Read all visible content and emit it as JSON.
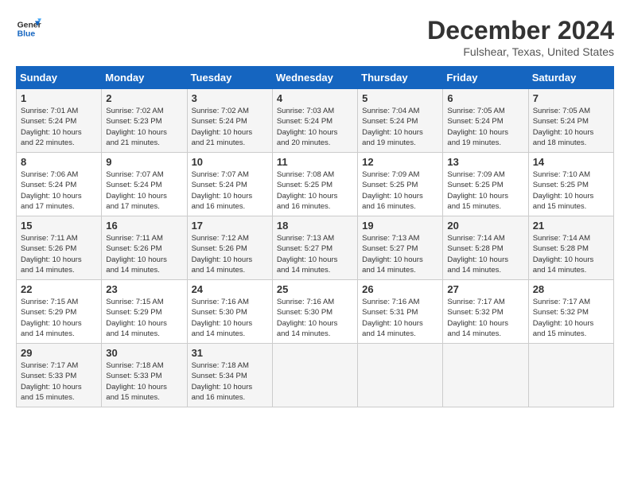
{
  "header": {
    "logo_line1": "General",
    "logo_line2": "Blue",
    "title": "December 2024",
    "subtitle": "Fulshear, Texas, United States"
  },
  "days_of_week": [
    "Sunday",
    "Monday",
    "Tuesday",
    "Wednesday",
    "Thursday",
    "Friday",
    "Saturday"
  ],
  "weeks": [
    [
      {
        "day": "1",
        "detail": "Sunrise: 7:01 AM\nSunset: 5:24 PM\nDaylight: 10 hours\nand 22 minutes."
      },
      {
        "day": "2",
        "detail": "Sunrise: 7:02 AM\nSunset: 5:23 PM\nDaylight: 10 hours\nand 21 minutes."
      },
      {
        "day": "3",
        "detail": "Sunrise: 7:02 AM\nSunset: 5:24 PM\nDaylight: 10 hours\nand 21 minutes."
      },
      {
        "day": "4",
        "detail": "Sunrise: 7:03 AM\nSunset: 5:24 PM\nDaylight: 10 hours\nand 20 minutes."
      },
      {
        "day": "5",
        "detail": "Sunrise: 7:04 AM\nSunset: 5:24 PM\nDaylight: 10 hours\nand 19 minutes."
      },
      {
        "day": "6",
        "detail": "Sunrise: 7:05 AM\nSunset: 5:24 PM\nDaylight: 10 hours\nand 19 minutes."
      },
      {
        "day": "7",
        "detail": "Sunrise: 7:05 AM\nSunset: 5:24 PM\nDaylight: 10 hours\nand 18 minutes."
      }
    ],
    [
      {
        "day": "8",
        "detail": "Sunrise: 7:06 AM\nSunset: 5:24 PM\nDaylight: 10 hours\nand 17 minutes."
      },
      {
        "day": "9",
        "detail": "Sunrise: 7:07 AM\nSunset: 5:24 PM\nDaylight: 10 hours\nand 17 minutes."
      },
      {
        "day": "10",
        "detail": "Sunrise: 7:07 AM\nSunset: 5:24 PM\nDaylight: 10 hours\nand 16 minutes."
      },
      {
        "day": "11",
        "detail": "Sunrise: 7:08 AM\nSunset: 5:25 PM\nDaylight: 10 hours\nand 16 minutes."
      },
      {
        "day": "12",
        "detail": "Sunrise: 7:09 AM\nSunset: 5:25 PM\nDaylight: 10 hours\nand 16 minutes."
      },
      {
        "day": "13",
        "detail": "Sunrise: 7:09 AM\nSunset: 5:25 PM\nDaylight: 10 hours\nand 15 minutes."
      },
      {
        "day": "14",
        "detail": "Sunrise: 7:10 AM\nSunset: 5:25 PM\nDaylight: 10 hours\nand 15 minutes."
      }
    ],
    [
      {
        "day": "15",
        "detail": "Sunrise: 7:11 AM\nSunset: 5:26 PM\nDaylight: 10 hours\nand 14 minutes."
      },
      {
        "day": "16",
        "detail": "Sunrise: 7:11 AM\nSunset: 5:26 PM\nDaylight: 10 hours\nand 14 minutes."
      },
      {
        "day": "17",
        "detail": "Sunrise: 7:12 AM\nSunset: 5:26 PM\nDaylight: 10 hours\nand 14 minutes."
      },
      {
        "day": "18",
        "detail": "Sunrise: 7:13 AM\nSunset: 5:27 PM\nDaylight: 10 hours\nand 14 minutes."
      },
      {
        "day": "19",
        "detail": "Sunrise: 7:13 AM\nSunset: 5:27 PM\nDaylight: 10 hours\nand 14 minutes."
      },
      {
        "day": "20",
        "detail": "Sunrise: 7:14 AM\nSunset: 5:28 PM\nDaylight: 10 hours\nand 14 minutes."
      },
      {
        "day": "21",
        "detail": "Sunrise: 7:14 AM\nSunset: 5:28 PM\nDaylight: 10 hours\nand 14 minutes."
      }
    ],
    [
      {
        "day": "22",
        "detail": "Sunrise: 7:15 AM\nSunset: 5:29 PM\nDaylight: 10 hours\nand 14 minutes."
      },
      {
        "day": "23",
        "detail": "Sunrise: 7:15 AM\nSunset: 5:29 PM\nDaylight: 10 hours\nand 14 minutes."
      },
      {
        "day": "24",
        "detail": "Sunrise: 7:16 AM\nSunset: 5:30 PM\nDaylight: 10 hours\nand 14 minutes."
      },
      {
        "day": "25",
        "detail": "Sunrise: 7:16 AM\nSunset: 5:30 PM\nDaylight: 10 hours\nand 14 minutes."
      },
      {
        "day": "26",
        "detail": "Sunrise: 7:16 AM\nSunset: 5:31 PM\nDaylight: 10 hours\nand 14 minutes."
      },
      {
        "day": "27",
        "detail": "Sunrise: 7:17 AM\nSunset: 5:32 PM\nDaylight: 10 hours\nand 14 minutes."
      },
      {
        "day": "28",
        "detail": "Sunrise: 7:17 AM\nSunset: 5:32 PM\nDaylight: 10 hours\nand 15 minutes."
      }
    ],
    [
      {
        "day": "29",
        "detail": "Sunrise: 7:17 AM\nSunset: 5:33 PM\nDaylight: 10 hours\nand 15 minutes."
      },
      {
        "day": "30",
        "detail": "Sunrise: 7:18 AM\nSunset: 5:33 PM\nDaylight: 10 hours\nand 15 minutes."
      },
      {
        "day": "31",
        "detail": "Sunrise: 7:18 AM\nSunset: 5:34 PM\nDaylight: 10 hours\nand 16 minutes."
      },
      {
        "day": "",
        "detail": ""
      },
      {
        "day": "",
        "detail": ""
      },
      {
        "day": "",
        "detail": ""
      },
      {
        "day": "",
        "detail": ""
      }
    ]
  ]
}
